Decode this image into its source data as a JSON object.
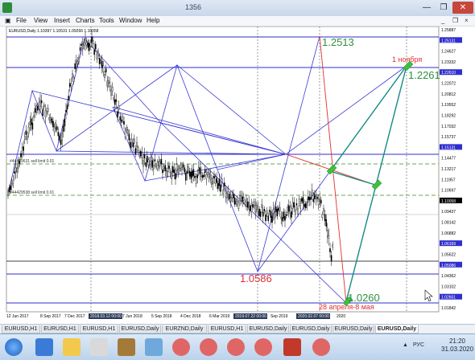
{
  "window": {
    "title": "1356",
    "minimize": "—",
    "maximize": "❐",
    "close": "✕"
  },
  "menu": {
    "items": [
      "File",
      "View",
      "Insert",
      "Charts",
      "Tools",
      "Window",
      "Help"
    ],
    "mdi_controls": [
      "_",
      "❐",
      "×"
    ]
  },
  "chart": {
    "header": "EURUSD,Daily  1.10397 1.10531 1.09266 1.10058",
    "current_price": "1.10058",
    "price_labels": [
      "1.25887",
      "1.25131",
      "1.24627",
      "1.23332",
      "1.22610",
      "1.22072",
      "1.20812",
      "1.19552",
      "1.18292",
      "1.17032",
      "1.15737",
      "1.15131",
      "1.14477",
      "1.13217",
      "1.11957",
      "1.10697",
      "1.10058",
      "1.09437",
      "1.08142",
      "1.06882",
      "1.06169",
      "1.05622",
      "1.05086",
      "1.04362",
      "1.03102",
      "1.02601",
      "1.01842"
    ],
    "date_labels": [
      "12 Jun 2017",
      "8 Sep 2017",
      "7 Dec 2017",
      "2018.03.12 00:00",
      "7 Jun 2018",
      "5 Sep 2018",
      "4 Dec 2018",
      "6 Mar 2019",
      "2019.07.22 00:00",
      "Sep 2019",
      "2020.02.07 00:00",
      "2020"
    ],
    "order_labels": [
      "#44429631 sell limit 0.01",
      "#44429538 sell limit 0.01"
    ],
    "annotations": {
      "level_high": "1.2513",
      "level_target": "1.2261",
      "date_november": "1 ноября",
      "level_mid": "1.0586",
      "level_low": "1.0260",
      "date_april_may": "28 апреля-8 мая"
    },
    "colors": {
      "candles": "#000000",
      "grid": "#c0c0c0",
      "fan_lines": "#3b3bd6",
      "horizontal_levels": "#2f2fcf",
      "order_lines": "#6aa84f",
      "red_line": "#e03030",
      "teal_line": "#138a83",
      "green_text": "#2f8f3f",
      "red_text": "#e03030"
    }
  },
  "tabs": [
    "EURUSD,H1",
    "EURUSD,H1",
    "EURUSD,H1",
    "EURUSD,Daily",
    "EURZND,Daily",
    "EURUSD,H1",
    "EURUSD,Daily",
    "EURUSD,Daily",
    "EURUSD,Daily",
    "EURUSD,Daily"
  ],
  "active_tab_index": 9,
  "taskbar": {
    "language": "РУС",
    "time": "21:20",
    "date": "31.03.2020"
  }
}
